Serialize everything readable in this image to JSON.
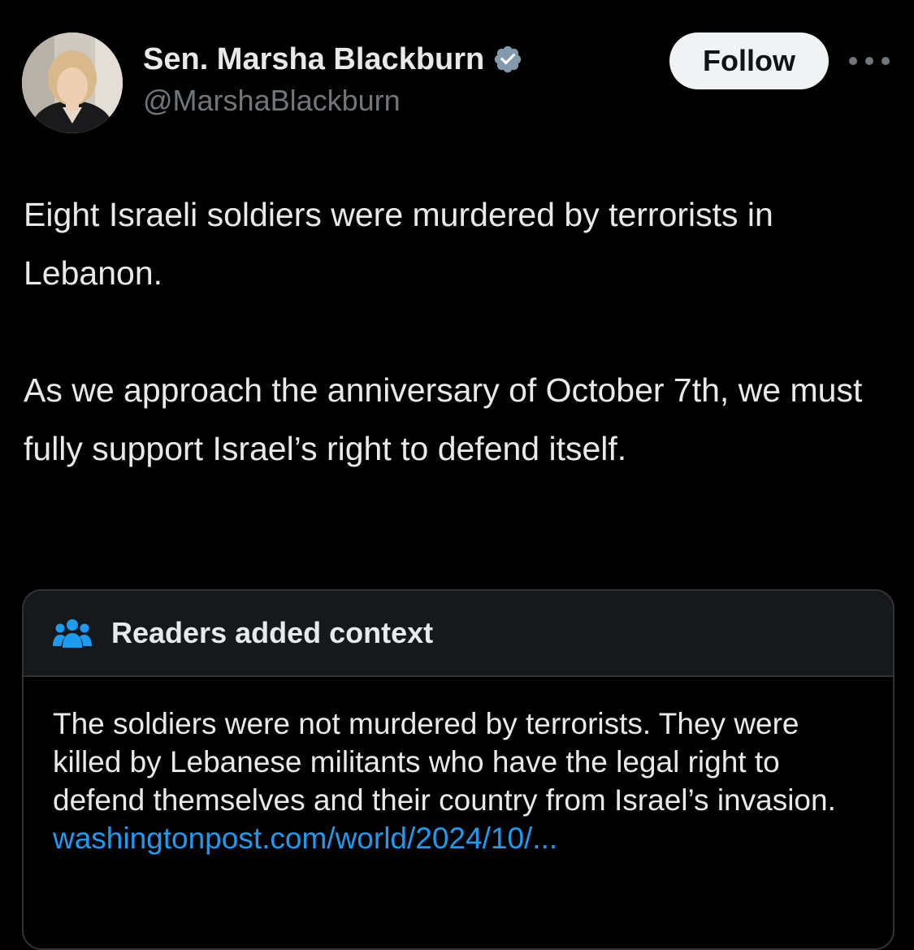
{
  "author": {
    "display_name": "Sen. Marsha Blackburn",
    "handle": "@MarshaBlackburn",
    "verified_icon": "verified-badge-icon"
  },
  "actions": {
    "follow_label": "Follow",
    "more_icon": "more-options-icon"
  },
  "tweet": {
    "paragraphs": [
      "Eight Israeli soldiers were murdered by terrorists in Lebanon.",
      "As we approach the anniversary of October 7th, we must fully support Israel’s right to defend itself."
    ]
  },
  "community_note": {
    "icon": "people-icon",
    "title": "Readers added context",
    "text": "The soldiers were not murdered by terrorists. They were killed by Lebanese militants who have the legal right to defend themselves and their country from Israel’s invasion.",
    "link_text": "washingtonpost.com/world/2024/10/..."
  },
  "colors": {
    "background": "#000000",
    "text_primary": "#e7e9ea",
    "text_secondary": "#71767b",
    "link": "#1d9bf0",
    "note_header_bg": "#16181c",
    "verified": "#829aab"
  }
}
